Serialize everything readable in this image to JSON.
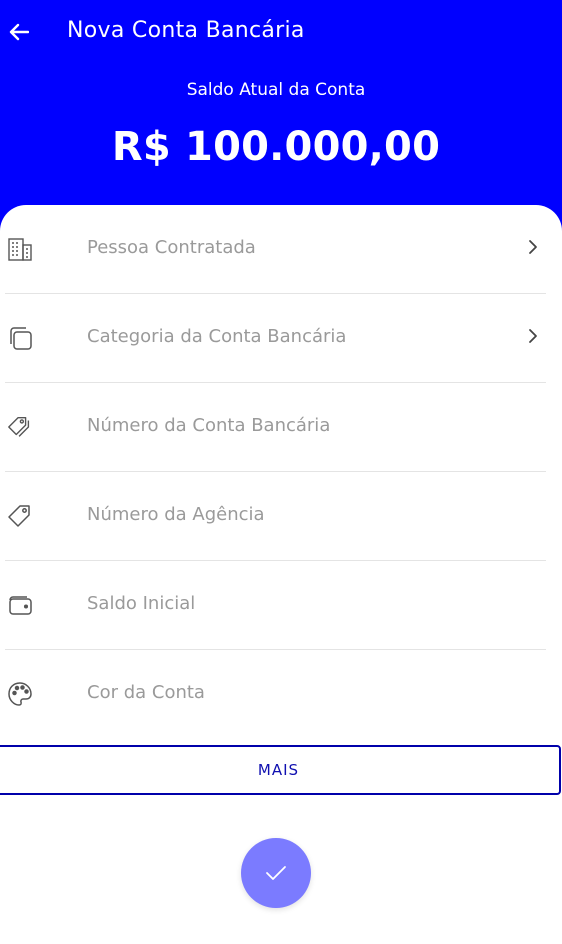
{
  "header": {
    "title": "Nova Conta Bancária",
    "balance_label": "Saldo Atual da Conta",
    "balance_value": "R$ 100.000,00",
    "background_color": "#0000ff"
  },
  "form": {
    "rows": [
      {
        "label": "Pessoa Contratada",
        "icon": "building-icon",
        "has_chevron": true
      },
      {
        "label": "Categoria da Conta Bancária",
        "icon": "stacked-squares-icon",
        "has_chevron": true
      },
      {
        "label": "Número da Conta Bancária",
        "icon": "tags-icon",
        "has_chevron": false
      },
      {
        "label": "Número da Agência",
        "icon": "tag-icon",
        "has_chevron": false
      },
      {
        "label": "Saldo Inicial",
        "icon": "wallet-icon",
        "has_chevron": false
      },
      {
        "label": "Cor da Conta",
        "icon": "palette-icon",
        "has_chevron": false
      }
    ]
  },
  "actions": {
    "more_label": "MAIS",
    "confirm_icon": "check-icon",
    "fab_color": "#7b7bff",
    "more_color": "#0000aa"
  }
}
